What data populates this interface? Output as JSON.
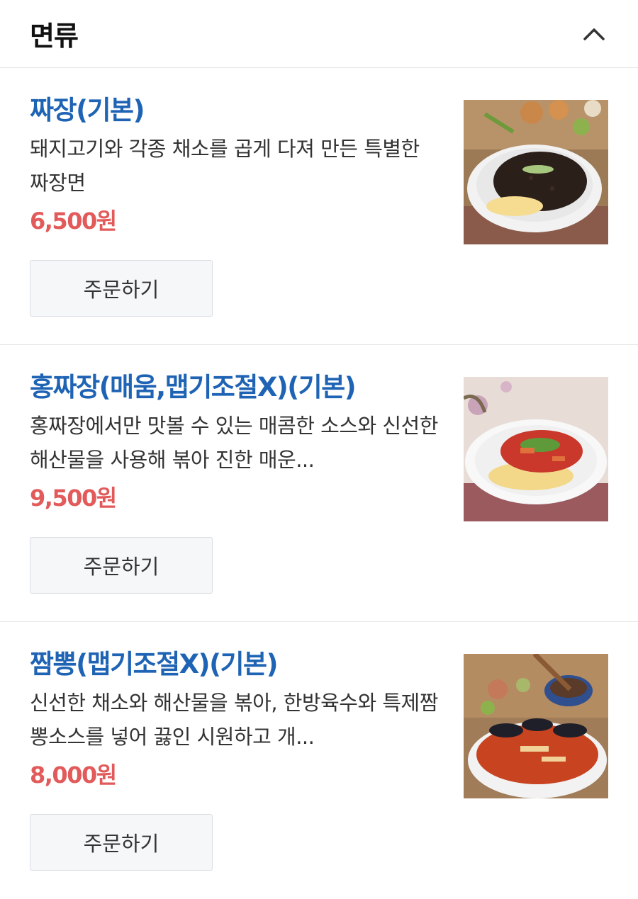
{
  "section": {
    "title": "면류",
    "toggle_icon": "chevron-up-icon"
  },
  "items": [
    {
      "name": "짜장(기본)",
      "description": "돼지고기와 각종 채소를 곱게 다져 만든 특별한 짜장면",
      "price": "6,500원",
      "button_label": "주문하기"
    },
    {
      "name": "홍짜장(매움,맵기조절X)(기본)",
      "description": "홍짜장에서만 맛볼 수 있는 매콤한 소스와 신선한 해산물을 사용해 볶아 진한 매운...",
      "price": "9,500원",
      "button_label": "주문하기"
    },
    {
      "name": "짬뽕(맵기조절X)(기본)",
      "description": "신선한 채소와 해산물을 볶아, 한방육수와 특제짬뽕소스를 넣어 끓인 시원하고 개...",
      "price": "8,000원",
      "button_label": "주문하기"
    }
  ],
  "colors": {
    "name": "#1f64b4",
    "price": "#e25a5a",
    "button_bg": "#f6f7f9",
    "divider": "#e6e6e6"
  }
}
